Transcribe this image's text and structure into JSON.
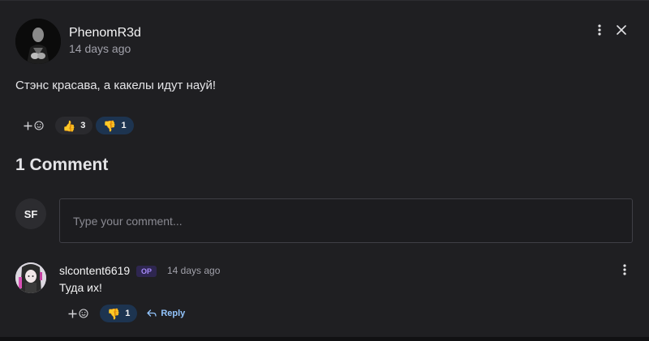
{
  "post": {
    "author": "PhenomR3d",
    "time": "14 days ago",
    "body": "Стэнс красава, а какелы идут науй!",
    "reactions": [
      {
        "icon": "thumbs-up-icon",
        "emoji": "👍",
        "count": "3",
        "active": false
      },
      {
        "icon": "thumbs-down-icon",
        "emoji": "👎",
        "count": "1",
        "active": true
      }
    ]
  },
  "comments": {
    "heading": "1 Comment",
    "current_user_initials": "SF",
    "input_placeholder": "Type your comment...",
    "items": [
      {
        "author": "slcontent6619",
        "badge": "OP",
        "time": "14 days ago",
        "body": "Туда их!",
        "reaction": {
          "icon": "thumbs-down-icon",
          "emoji": "👎",
          "count": "1"
        },
        "reply_label": "Reply"
      }
    ]
  },
  "colors": {
    "panel_bg": "#1f1f22",
    "page_bg": "#111113",
    "accent_link": "#93c5fd",
    "active_pill": "#1d3450",
    "op_badge_bg": "#2e2650",
    "op_badge_text": "#a78bfa"
  }
}
